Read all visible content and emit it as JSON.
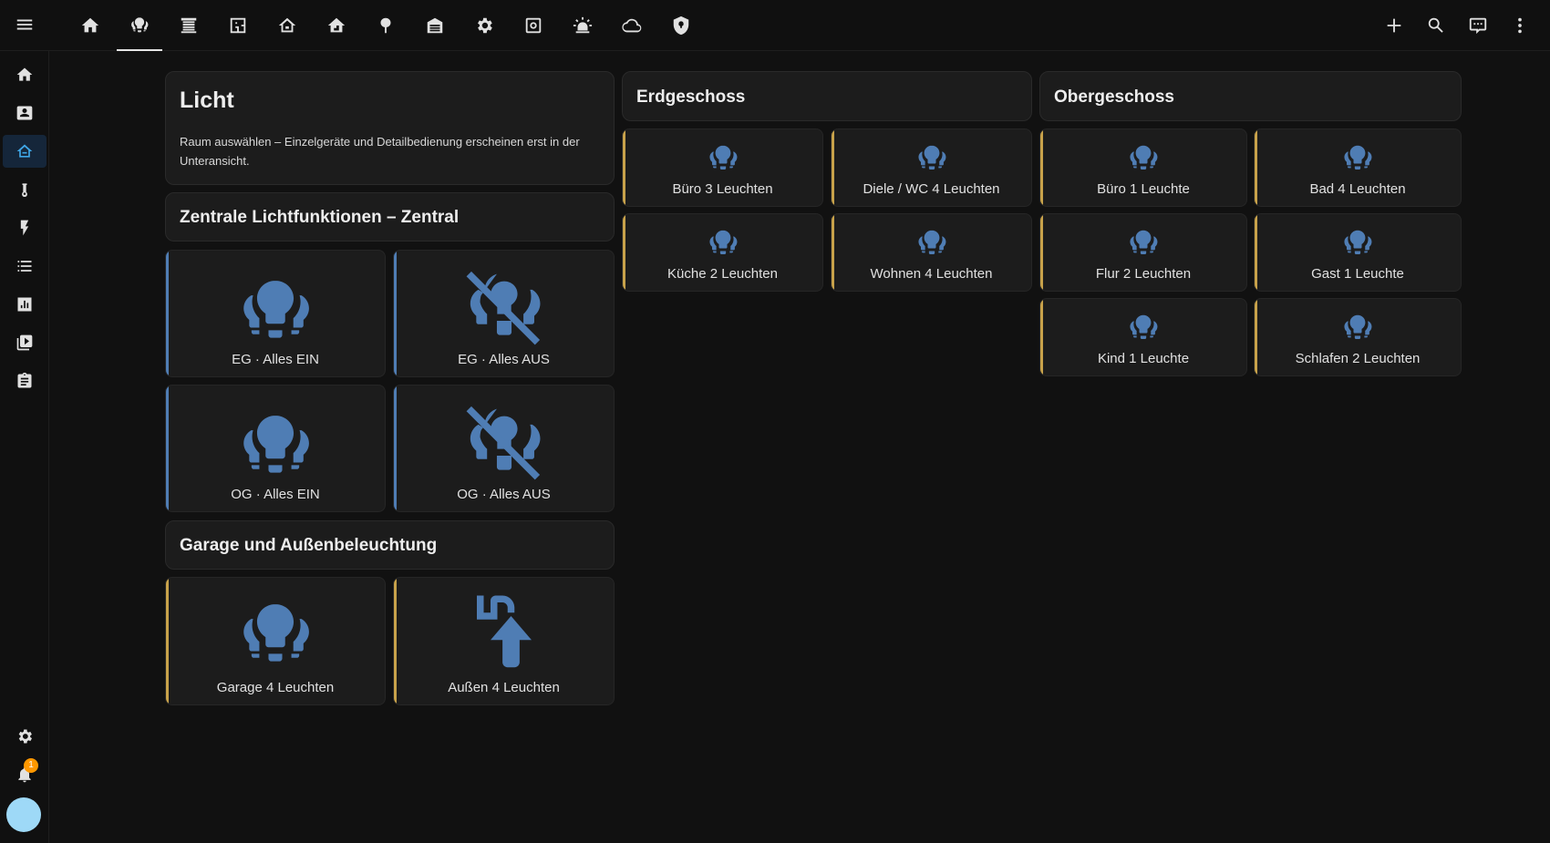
{
  "colors": {
    "accent_gold": "#c8a24a",
    "accent_blue": "#4f7db4",
    "icon_blue": "#4f7db4",
    "active_nav": "#3fa7e8",
    "badge": "#ff9800",
    "avatar": "#9ed9f7"
  },
  "topbar": {
    "menu_icon": "menu-icon",
    "tabs": [
      {
        "icon": "home-icon",
        "active": false
      },
      {
        "icon": "lightbulb-group-icon",
        "active": true
      },
      {
        "icon": "blinds-icon",
        "active": false
      },
      {
        "icon": "floor-plan-icon",
        "active": false
      },
      {
        "icon": "home-floor-icon",
        "active": false
      },
      {
        "icon": "home-upstairs-icon",
        "active": false
      },
      {
        "icon": "tree-icon",
        "active": false
      },
      {
        "icon": "garage-icon",
        "active": false
      },
      {
        "icon": "cog-icon",
        "active": false
      },
      {
        "icon": "robot-icon",
        "active": false
      },
      {
        "icon": "alarm-light-icon",
        "active": false
      },
      {
        "icon": "cloud-icon",
        "active": false
      },
      {
        "icon": "shield-icon",
        "active": false
      }
    ],
    "actions": [
      "add-icon",
      "search-icon",
      "assist-icon",
      "more-vertical-icon"
    ]
  },
  "sidebar": {
    "items": [
      "home-icon",
      "account-box-icon",
      "home-active-icon",
      "thermometer-icon",
      "flash-icon",
      "list-icon",
      "chart-icon",
      "media-icon",
      "clipboard-icon"
    ],
    "bottom": [
      "settings-icon",
      "bell-icon"
    ],
    "notification_count": "1"
  },
  "licht": {
    "title": "Licht",
    "description": "Raum auswählen – Einzelgeräte und Detailbedienung erscheinen erst in der Unteransicht."
  },
  "zentral": {
    "title": "Zentrale Lichtfunktionen – Zentral",
    "tiles": [
      {
        "name": "EG · Alles EIN",
        "icon": "lightbulb-group-icon"
      },
      {
        "name": "EG · Alles AUS",
        "icon": "lightbulb-group-off-icon"
      },
      {
        "name": "OG · Alles EIN",
        "icon": "lightbulb-group-icon"
      },
      {
        "name": "OG · Alles AUS",
        "icon": "lightbulb-group-off-icon"
      }
    ]
  },
  "garage": {
    "title": "Garage und Außenbeleuchtung",
    "tiles": [
      {
        "name": "Garage 4 Leuchten",
        "icon": "lightbulb-group-icon"
      },
      {
        "name": "Außen 4 Leuchten",
        "icon": "outdoor-lamp-icon"
      }
    ]
  },
  "erdgeschoss": {
    "title": "Erdgeschoss",
    "tiles": [
      {
        "name": "Büro 3 Leuchten"
      },
      {
        "name": "Diele / WC 4 Leuchten"
      },
      {
        "name": "Küche 2 Leuchten"
      },
      {
        "name": "Wohnen 4 Leuchten"
      }
    ]
  },
  "obergeschoss": {
    "title": "Obergeschoss",
    "tiles": [
      {
        "name": "Büro 1 Leuchte"
      },
      {
        "name": "Bad 4 Leuchten"
      },
      {
        "name": "Flur 2 Leuchten"
      },
      {
        "name": "Gast 1 Leuchte"
      },
      {
        "name": "Kind 1 Leuchte"
      },
      {
        "name": "Schlafen 2 Leuchten"
      }
    ]
  }
}
